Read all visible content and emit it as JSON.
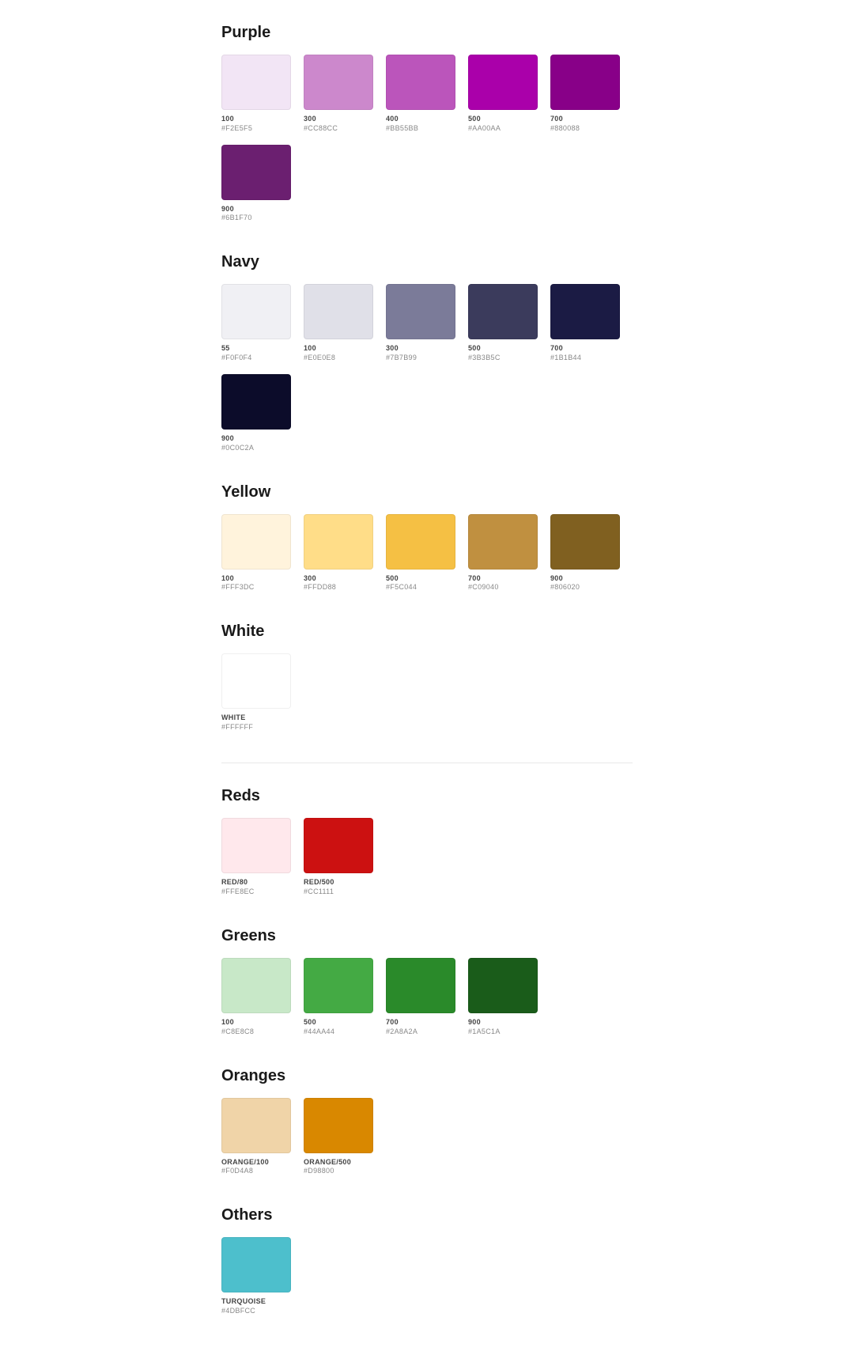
{
  "sections": [
    {
      "id": "purple",
      "title": "Purple",
      "colors": [
        {
          "label": "100",
          "hex": "#F2E5F5",
          "display": "100 #F2E5F5"
        },
        {
          "label": "300",
          "hex": "#CC88CC",
          "display": "300 #CC88CC"
        },
        {
          "label": "400",
          "hex": "#BB55BB",
          "display": "400 #BB55BB"
        },
        {
          "label": "500",
          "hex": "#AA00AA",
          "display": "500 #AA00AA"
        },
        {
          "label": "700",
          "hex": "#880088",
          "display": "700 #880088"
        },
        {
          "label": "900",
          "hex": "#6B1F70",
          "display": "900 #6B1F70"
        }
      ]
    },
    {
      "id": "navy",
      "title": "Navy",
      "colors": [
        {
          "label": "55",
          "hex": "#F0F0F4",
          "display": "55 #F0F0F4"
        },
        {
          "label": "100",
          "hex": "#E0E0E8",
          "display": "100 #E0E0E8"
        },
        {
          "label": "300",
          "hex": "#7B7B99",
          "display": "300 #7B7B99"
        },
        {
          "label": "500",
          "hex": "#3B3B5C",
          "display": "500 #3B3B5C"
        },
        {
          "label": "700",
          "hex": "#1B1B44",
          "display": "700 #1B1B44"
        },
        {
          "label": "900",
          "hex": "#0C0C2A",
          "display": "900 #0C0C2A"
        }
      ]
    },
    {
      "id": "yellow",
      "title": "Yellow",
      "colors": [
        {
          "label": "100",
          "hex": "#FFF3DC",
          "display": "100 #FFF3DC"
        },
        {
          "label": "300",
          "hex": "#FFDD88",
          "display": "300 #FFDD88"
        },
        {
          "label": "500",
          "hex": "#F5C044",
          "display": "500 #F5C044"
        },
        {
          "label": "700",
          "hex": "#C09040",
          "display": "700 #C09040"
        },
        {
          "label": "900",
          "hex": "#806020",
          "display": "900 #806020"
        }
      ]
    },
    {
      "id": "white",
      "title": "White",
      "colors": [
        {
          "label": "WHITE",
          "hex": "#FFFFFF",
          "display": "WHITE #FFFFFF"
        }
      ]
    }
  ],
  "sections2": [
    {
      "id": "reds",
      "title": "Reds",
      "colors": [
        {
          "label": "RED/80",
          "hex": "#FFE8EC",
          "display": "RED/80 #FFE8EC"
        },
        {
          "label": "RED/500",
          "hex": "#CC1111",
          "display": "RED/500 #CC1111"
        }
      ]
    },
    {
      "id": "greens",
      "title": "Greens",
      "colors": [
        {
          "label": "100",
          "hex": "#C8E8C8",
          "display": "100 #C8E8C8"
        },
        {
          "label": "500",
          "hex": "#44AA44",
          "display": "500 #44AA44"
        },
        {
          "label": "700",
          "hex": "#2A8A2A",
          "display": "700 #2A8A2A"
        },
        {
          "label": "900",
          "hex": "#1A5C1A",
          "display": "900 #1A5C1A"
        }
      ]
    },
    {
      "id": "oranges",
      "title": "Oranges",
      "colors": [
        {
          "label": "ORANGE/100",
          "hex": "#F0D4A8",
          "display": "ORANGE/100 #F0D4A8"
        },
        {
          "label": "ORANGE/500",
          "hex": "#D98800",
          "display": "ORANGE/500 #D98800"
        }
      ]
    },
    {
      "id": "others",
      "title": "Others",
      "colors": [
        {
          "label": "TURQUOISE",
          "hex": "#4DBFCC",
          "display": "TURQUOISE #4DBFCC"
        }
      ]
    }
  ]
}
